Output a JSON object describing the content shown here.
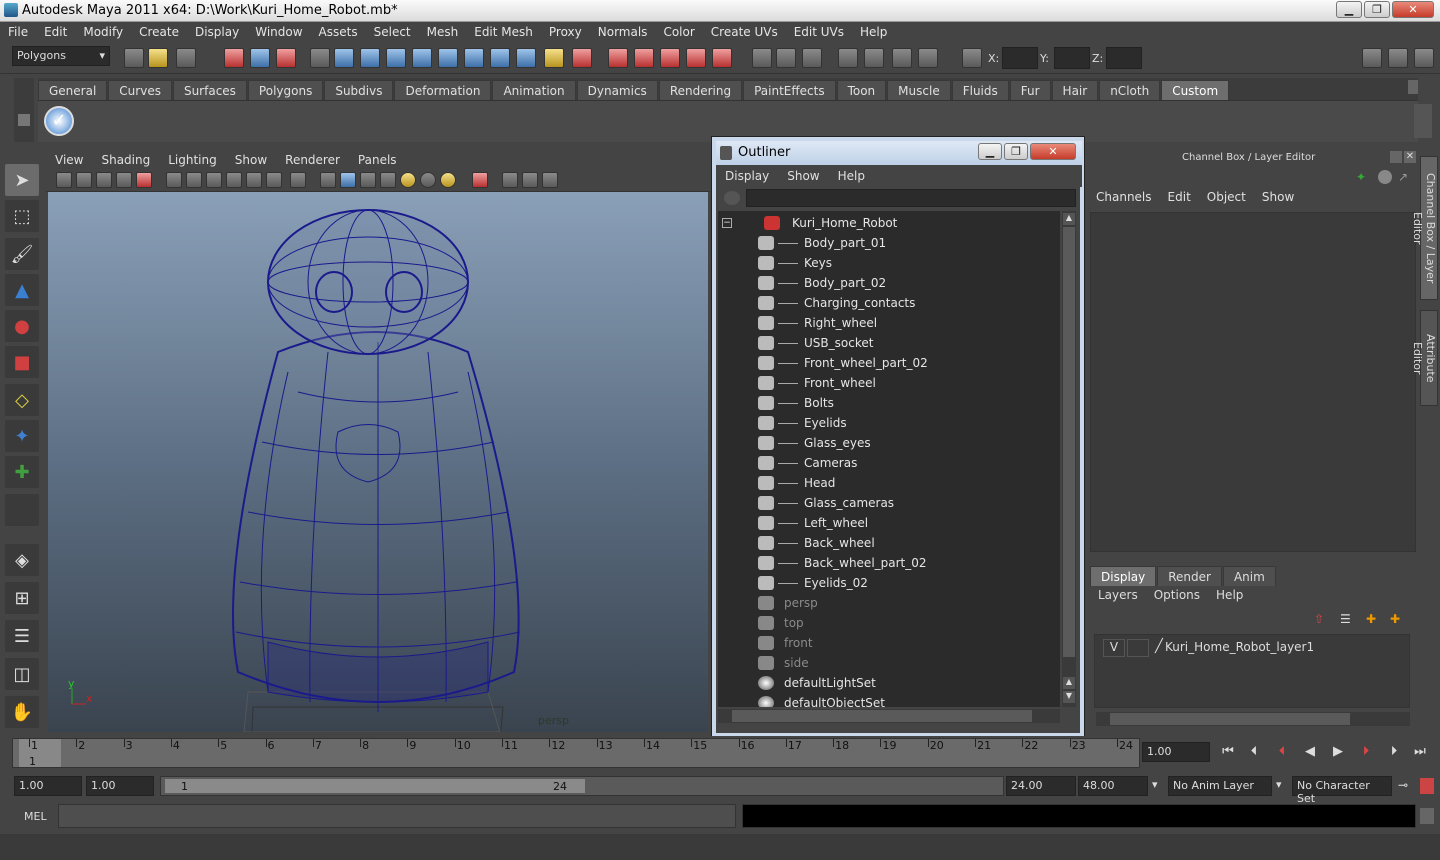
{
  "window": {
    "title": "Autodesk Maya 2011 x64: D:\\Work\\Kuri_Home_Robot.mb*"
  },
  "menubar": [
    "File",
    "Edit",
    "Modify",
    "Create",
    "Display",
    "Window",
    "Assets",
    "Select",
    "Mesh",
    "Edit Mesh",
    "Proxy",
    "Normals",
    "Color",
    "Create UVs",
    "Edit UVs",
    "Help"
  ],
  "status": {
    "mode": "Polygons",
    "x_label": "X:",
    "y_label": "Y:",
    "z_label": "Z:"
  },
  "shelf": {
    "tabs": [
      "General",
      "Curves",
      "Surfaces",
      "Polygons",
      "Subdivs",
      "Deformation",
      "Animation",
      "Dynamics",
      "Rendering",
      "PaintEffects",
      "Toon",
      "Muscle",
      "Fluids",
      "Fur",
      "Hair",
      "nCloth",
      "Custom"
    ],
    "active": "Custom"
  },
  "viewport": {
    "menu": [
      "View",
      "Shading",
      "Lighting",
      "Show",
      "Renderer",
      "Panels"
    ],
    "camera": "persp",
    "axis_x": "x",
    "axis_y": "y",
    "colors": {
      "wire": "#1a1a8c"
    }
  },
  "outliner": {
    "title": "Outliner",
    "menu": [
      "Display",
      "Show",
      "Help"
    ],
    "root": "Kuri_Home_Robot",
    "children": [
      "Body_part_01",
      "Keys",
      "Body_part_02",
      "Charging_contacts",
      "Right_wheel",
      "USB_socket",
      "Front_wheel_part_02",
      "Front_wheel",
      "Bolts",
      "Eyelids",
      "Glass_eyes",
      "Cameras",
      "Head",
      "Glass_cameras",
      "Left_wheel",
      "Back_wheel",
      "Back_wheel_part_02",
      "Eyelids_02"
    ],
    "cameras": [
      "persp",
      "top",
      "front",
      "side"
    ],
    "sets": [
      "defaultLightSet",
      "defaultObjectSet"
    ]
  },
  "channelbox": {
    "title": "Channel Box / Layer Editor",
    "menu": [
      "Channels",
      "Edit",
      "Object",
      "Show"
    ],
    "layer_tabs": [
      "Display",
      "Render",
      "Anim"
    ],
    "layer_active": "Display",
    "layer_menu": [
      "Layers",
      "Options",
      "Help"
    ],
    "layer_visible": "V",
    "layer_name": "Kuri_Home_Robot_layer1",
    "side_tab_1": "Channel Box / Layer Editor",
    "side_tab_2": "Attribute Editor"
  },
  "timeslider": {
    "frames": [
      "1",
      "2",
      "3",
      "4",
      "5",
      "6",
      "7",
      "8",
      "9",
      "10",
      "11",
      "12",
      "13",
      "14",
      "15",
      "16",
      "17",
      "18",
      "19",
      "20",
      "21",
      "22",
      "23",
      "24"
    ],
    "current_mark": "1",
    "current": "1.00"
  },
  "rangeslider": {
    "start": "1.00",
    "start_inner": "1.00",
    "range_lo": "1",
    "range_hi": "24",
    "end": "24.00",
    "end_outer": "48.00",
    "anim_layer": "No Anim Layer",
    "char_set": "No Character Set"
  },
  "cmdline": {
    "label": "MEL"
  }
}
